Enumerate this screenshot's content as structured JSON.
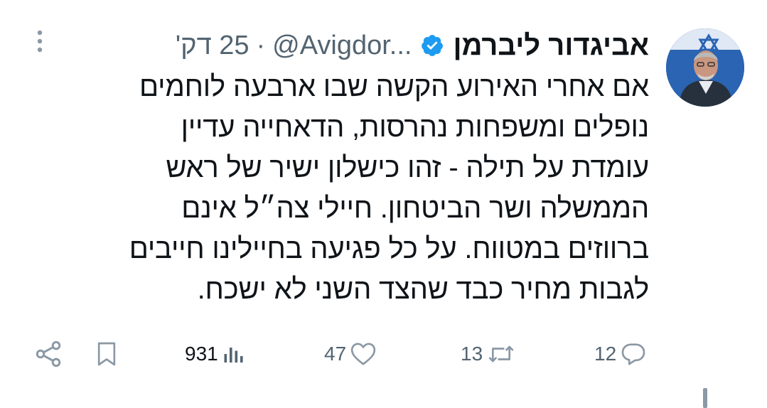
{
  "tweet": {
    "author": {
      "display_name": "אביגדור ליברמן",
      "handle": "@Avigdor...",
      "verified": true,
      "avatar_icon": "profile-photo"
    },
    "separator": "·",
    "time": "25 דק'",
    "text": "אם אחרי האירוע הקשה שבו ארבעה לוחמים\nנופלים ומשפחות נהרסות, הדאחייה עדיין\nעומדת על תילה - זהו כישלון ישיר של ראש\nהממשלה ושר הביטחון. חיילי צה״ל אינם\nברווזים במטווח. על כל פגיעה בחיילינו חייבים\nלגבות מחיר כבד שהצד השני לא ישכח.",
    "actions": {
      "replies": "12",
      "retweets": "13",
      "likes": "47",
      "views": "931"
    }
  },
  "colors": {
    "text": "#0f1419",
    "secondary": "#536471",
    "verified": "#1d9bf0"
  },
  "icons": {
    "more": "more-vertical-icon",
    "verified": "verified-badge-icon",
    "reply": "reply-icon",
    "retweet": "retweet-icon",
    "like": "heart-icon",
    "views": "views-icon",
    "bookmark": "bookmark-icon",
    "share": "share-icon"
  }
}
